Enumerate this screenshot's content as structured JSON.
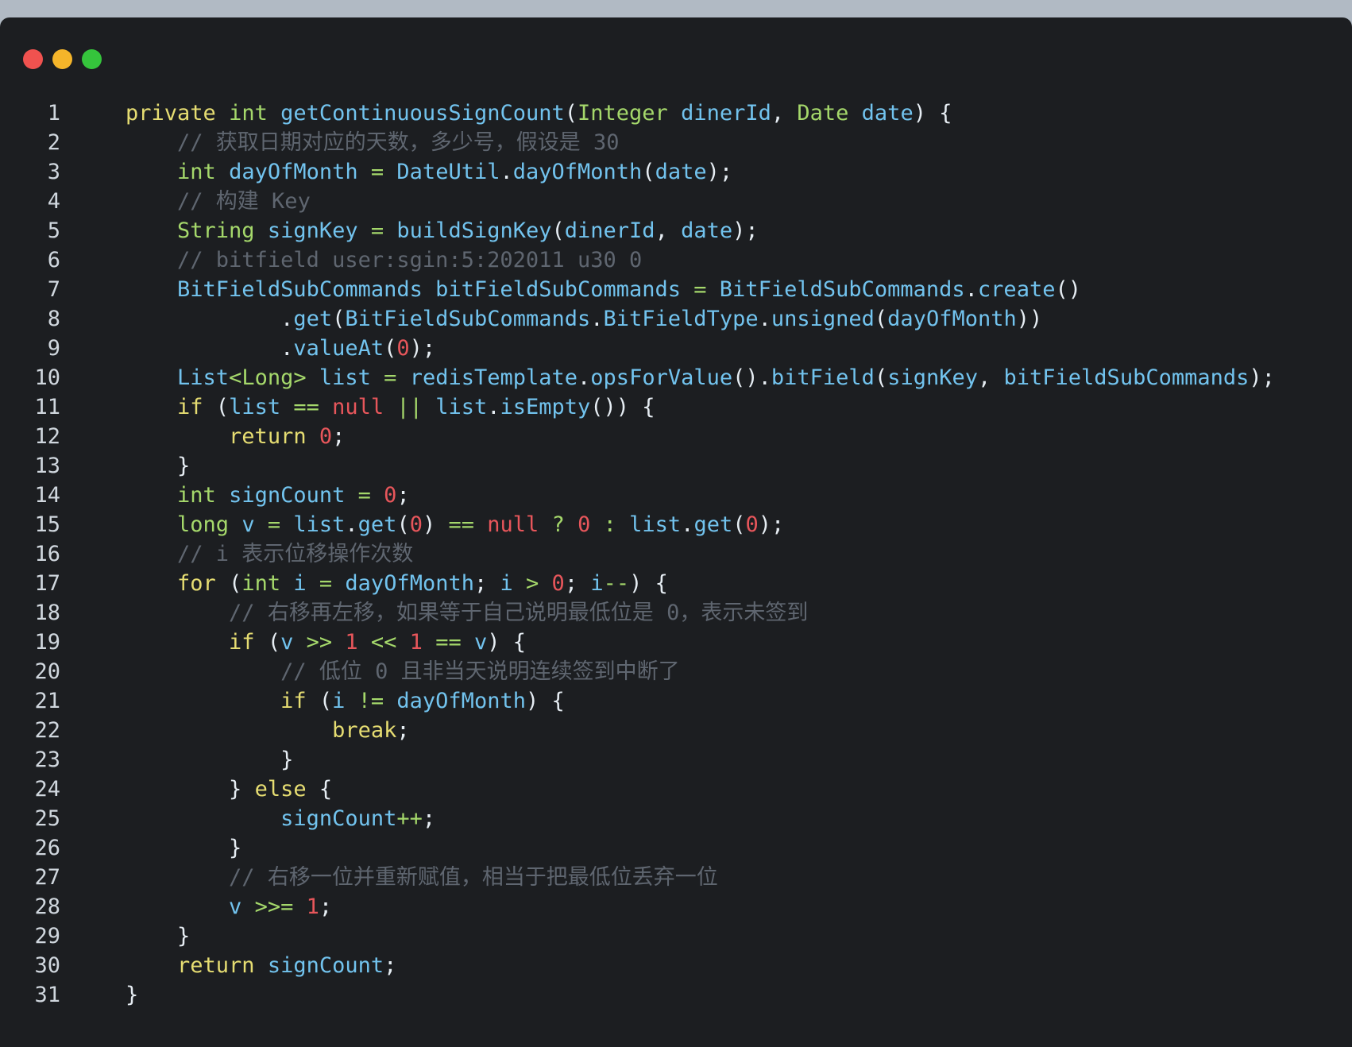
{
  "window": {
    "controls": [
      {
        "name": "close",
        "color": "#f0524f"
      },
      {
        "name": "minimize",
        "color": "#f5b52a"
      },
      {
        "name": "maximize",
        "color": "#35c43c"
      }
    ]
  },
  "code": {
    "lines": [
      {
        "n": "1",
        "indent": 0,
        "tokens": [
          [
            "kw",
            "private"
          ],
          [
            "sp",
            " "
          ],
          [
            "ty",
            "int"
          ],
          [
            "sp",
            " "
          ],
          [
            "fn",
            "getContinuousSignCount"
          ],
          [
            "pun",
            "("
          ],
          [
            "ty",
            "Integer"
          ],
          [
            "sp",
            " "
          ],
          [
            "id",
            "dinerId"
          ],
          [
            "pun",
            ", "
          ],
          [
            "ty",
            "Date"
          ],
          [
            "sp",
            " "
          ],
          [
            "id",
            "date"
          ],
          [
            "pun",
            ") {"
          ]
        ]
      },
      {
        "n": "2",
        "indent": 1,
        "tokens": [
          [
            "cm",
            "// 获取日期对应的天数，多少号，假设是 30"
          ]
        ]
      },
      {
        "n": "3",
        "indent": 1,
        "tokens": [
          [
            "ty",
            "int"
          ],
          [
            "sp",
            " "
          ],
          [
            "id",
            "dayOfMonth"
          ],
          [
            "op",
            " = "
          ],
          [
            "id",
            "DateUtil"
          ],
          [
            "pun",
            "."
          ],
          [
            "fn",
            "dayOfMonth"
          ],
          [
            "pun",
            "("
          ],
          [
            "id",
            "date"
          ],
          [
            "pun",
            ");"
          ]
        ]
      },
      {
        "n": "4",
        "indent": 1,
        "tokens": [
          [
            "cm",
            "// 构建 Key"
          ]
        ]
      },
      {
        "n": "5",
        "indent": 1,
        "tokens": [
          [
            "ty",
            "String"
          ],
          [
            "sp",
            " "
          ],
          [
            "id",
            "signKey"
          ],
          [
            "op",
            " = "
          ],
          [
            "fn",
            "buildSignKey"
          ],
          [
            "pun",
            "("
          ],
          [
            "id",
            "dinerId"
          ],
          [
            "pun",
            ", "
          ],
          [
            "id",
            "date"
          ],
          [
            "pun",
            ");"
          ]
        ]
      },
      {
        "n": "6",
        "indent": 1,
        "tokens": [
          [
            "cm",
            "// bitfield user:sgin:5:202011 u30 0"
          ]
        ]
      },
      {
        "n": "7",
        "indent": 1,
        "tokens": [
          [
            "id",
            "BitFieldSubCommands"
          ],
          [
            "sp",
            " "
          ],
          [
            "id",
            "bitFieldSubCommands"
          ],
          [
            "op",
            " = "
          ],
          [
            "id",
            "BitFieldSubCommands"
          ],
          [
            "pun",
            "."
          ],
          [
            "fn",
            "create"
          ],
          [
            "pun",
            "()"
          ]
        ]
      },
      {
        "n": "8",
        "indent": 3,
        "tokens": [
          [
            "pun",
            "."
          ],
          [
            "fn",
            "get"
          ],
          [
            "pun",
            "("
          ],
          [
            "id",
            "BitFieldSubCommands"
          ],
          [
            "pun",
            "."
          ],
          [
            "id",
            "BitFieldType"
          ],
          [
            "pun",
            "."
          ],
          [
            "fn",
            "unsigned"
          ],
          [
            "pun",
            "("
          ],
          [
            "id",
            "dayOfMonth"
          ],
          [
            "pun",
            "))"
          ]
        ]
      },
      {
        "n": "9",
        "indent": 3,
        "tokens": [
          [
            "pun",
            "."
          ],
          [
            "fn",
            "valueAt"
          ],
          [
            "pun",
            "("
          ],
          [
            "num",
            "0"
          ],
          [
            "pun",
            ");"
          ]
        ]
      },
      {
        "n": "10",
        "indent": 1,
        "tokens": [
          [
            "id",
            "List"
          ],
          [
            "op",
            "<"
          ],
          [
            "ty",
            "Long"
          ],
          [
            "op",
            ">"
          ],
          [
            "sp",
            " "
          ],
          [
            "id",
            "list"
          ],
          [
            "op",
            " = "
          ],
          [
            "id",
            "redisTemplate"
          ],
          [
            "pun",
            "."
          ],
          [
            "fn",
            "opsForValue"
          ],
          [
            "pun",
            "()."
          ],
          [
            "fn",
            "bitField"
          ],
          [
            "pun",
            "("
          ],
          [
            "id",
            "signKey"
          ],
          [
            "pun",
            ", "
          ],
          [
            "id",
            "bitFieldSubCommands"
          ],
          [
            "pun",
            ");"
          ]
        ]
      },
      {
        "n": "11",
        "indent": 1,
        "tokens": [
          [
            "kw",
            "if"
          ],
          [
            "pun",
            " ("
          ],
          [
            "id",
            "list"
          ],
          [
            "op",
            " == "
          ],
          [
            "nul",
            "null"
          ],
          [
            "op",
            " || "
          ],
          [
            "id",
            "list"
          ],
          [
            "pun",
            "."
          ],
          [
            "fn",
            "isEmpty"
          ],
          [
            "pun",
            "()) {"
          ]
        ]
      },
      {
        "n": "12",
        "indent": 2,
        "tokens": [
          [
            "kw",
            "return"
          ],
          [
            "sp",
            " "
          ],
          [
            "num",
            "0"
          ],
          [
            "pun",
            ";"
          ]
        ]
      },
      {
        "n": "13",
        "indent": 1,
        "tokens": [
          [
            "pun",
            "}"
          ]
        ]
      },
      {
        "n": "14",
        "indent": 1,
        "tokens": [
          [
            "ty",
            "int"
          ],
          [
            "sp",
            " "
          ],
          [
            "id",
            "signCount"
          ],
          [
            "op",
            " = "
          ],
          [
            "num",
            "0"
          ],
          [
            "pun",
            ";"
          ]
        ]
      },
      {
        "n": "15",
        "indent": 1,
        "tokens": [
          [
            "ty",
            "long"
          ],
          [
            "sp",
            " "
          ],
          [
            "id",
            "v"
          ],
          [
            "op",
            " = "
          ],
          [
            "id",
            "list"
          ],
          [
            "pun",
            "."
          ],
          [
            "fn",
            "get"
          ],
          [
            "pun",
            "("
          ],
          [
            "num",
            "0"
          ],
          [
            "pun",
            ")"
          ],
          [
            "op",
            " == "
          ],
          [
            "nul",
            "null"
          ],
          [
            "op",
            " ? "
          ],
          [
            "num",
            "0"
          ],
          [
            "op",
            " : "
          ],
          [
            "id",
            "list"
          ],
          [
            "pun",
            "."
          ],
          [
            "fn",
            "get"
          ],
          [
            "pun",
            "("
          ],
          [
            "num",
            "0"
          ],
          [
            "pun",
            ");"
          ]
        ]
      },
      {
        "n": "16",
        "indent": 1,
        "tokens": [
          [
            "cm",
            "// i 表示位移操作次数"
          ]
        ]
      },
      {
        "n": "17",
        "indent": 1,
        "tokens": [
          [
            "kw",
            "for"
          ],
          [
            "pun",
            " ("
          ],
          [
            "ty",
            "int"
          ],
          [
            "sp",
            " "
          ],
          [
            "id",
            "i"
          ],
          [
            "op",
            " = "
          ],
          [
            "id",
            "dayOfMonth"
          ],
          [
            "pun",
            "; "
          ],
          [
            "id",
            "i"
          ],
          [
            "op",
            " > "
          ],
          [
            "num",
            "0"
          ],
          [
            "pun",
            "; "
          ],
          [
            "id",
            "i"
          ],
          [
            "op",
            "--"
          ],
          [
            "pun",
            ") {"
          ]
        ]
      },
      {
        "n": "18",
        "indent": 2,
        "tokens": [
          [
            "cm",
            "// 右移再左移，如果等于自己说明最低位是 0，表示未签到"
          ]
        ]
      },
      {
        "n": "19",
        "indent": 2,
        "tokens": [
          [
            "kw",
            "if"
          ],
          [
            "pun",
            " ("
          ],
          [
            "id",
            "v"
          ],
          [
            "op",
            " >> "
          ],
          [
            "num",
            "1"
          ],
          [
            "op",
            " << "
          ],
          [
            "num",
            "1"
          ],
          [
            "op",
            " == "
          ],
          [
            "id",
            "v"
          ],
          [
            "pun",
            ") {"
          ]
        ]
      },
      {
        "n": "20",
        "indent": 3,
        "tokens": [
          [
            "cm",
            "// 低位 0 且非当天说明连续签到中断了"
          ]
        ]
      },
      {
        "n": "21",
        "indent": 3,
        "tokens": [
          [
            "kw",
            "if"
          ],
          [
            "pun",
            " ("
          ],
          [
            "id",
            "i"
          ],
          [
            "op",
            " != "
          ],
          [
            "id",
            "dayOfMonth"
          ],
          [
            "pun",
            ") {"
          ]
        ]
      },
      {
        "n": "22",
        "indent": 4,
        "tokens": [
          [
            "kw",
            "break"
          ],
          [
            "pun",
            ";"
          ]
        ]
      },
      {
        "n": "23",
        "indent": 3,
        "tokens": [
          [
            "pun",
            "}"
          ]
        ]
      },
      {
        "n": "24",
        "indent": 2,
        "tokens": [
          [
            "pun",
            "} "
          ],
          [
            "kw",
            "else"
          ],
          [
            "pun",
            " {"
          ]
        ]
      },
      {
        "n": "25",
        "indent": 3,
        "tokens": [
          [
            "id",
            "signCount"
          ],
          [
            "op",
            "++"
          ],
          [
            "pun",
            ";"
          ]
        ]
      },
      {
        "n": "26",
        "indent": 2,
        "tokens": [
          [
            "pun",
            "}"
          ]
        ]
      },
      {
        "n": "27",
        "indent": 2,
        "tokens": [
          [
            "cm",
            "// 右移一位并重新赋值，相当于把最低位丢弃一位"
          ]
        ]
      },
      {
        "n": "28",
        "indent": 2,
        "tokens": [
          [
            "id",
            "v"
          ],
          [
            "op",
            " >>= "
          ],
          [
            "num",
            "1"
          ],
          [
            "pun",
            ";"
          ]
        ]
      },
      {
        "n": "29",
        "indent": 1,
        "tokens": [
          [
            "pun",
            "}"
          ]
        ]
      },
      {
        "n": "30",
        "indent": 1,
        "tokens": [
          [
            "kw",
            "return"
          ],
          [
            "sp",
            " "
          ],
          [
            "id",
            "signCount"
          ],
          [
            "pun",
            ";"
          ]
        ]
      },
      {
        "n": "31",
        "indent": 0,
        "tokens": [
          [
            "pun",
            "}"
          ]
        ]
      }
    ]
  }
}
